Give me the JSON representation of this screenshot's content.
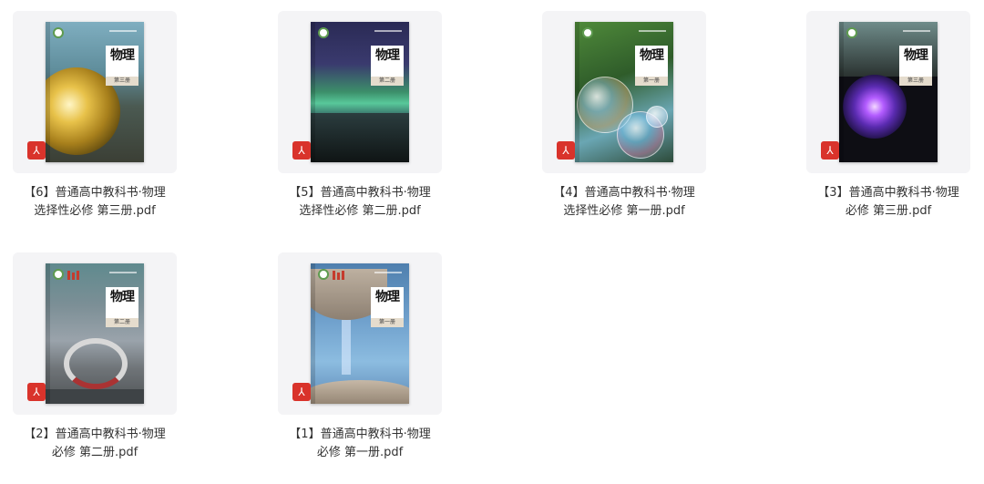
{
  "files": [
    {
      "line1": "【6】普通高中教科书·物理",
      "line2": "选择性必修 第三册.pdf",
      "cover_title": "物理",
      "volume": "第三册",
      "file_type_icon": "pdf-icon"
    },
    {
      "line1": "【5】普通高中教科书·物理",
      "line2": "选择性必修 第二册.pdf",
      "cover_title": "物理",
      "volume": "第二册",
      "file_type_icon": "pdf-icon"
    },
    {
      "line1": "【4】普通高中教科书·物理",
      "line2": "选择性必修 第一册.pdf",
      "cover_title": "物理",
      "volume": "第一册",
      "file_type_icon": "pdf-icon"
    },
    {
      "line1": "【3】普通高中教科书·物理",
      "line2": "必修 第三册.pdf",
      "cover_title": "物理",
      "volume": "第三册",
      "file_type_icon": "pdf-icon"
    },
    {
      "line1": "【2】普通高中教科书·物理",
      "line2": "必修 第二册.pdf",
      "cover_title": "物理",
      "volume": "第二册",
      "file_type_icon": "pdf-icon"
    },
    {
      "line1": "【1】普通高中教科书·物理",
      "line2": "必修 第一册.pdf",
      "cover_title": "物理",
      "volume": "第一册",
      "file_type_icon": "pdf-icon"
    }
  ],
  "colors": {
    "card_background": "#f4f4f6",
    "pdf_badge": "#d9332b",
    "caption_text": "#333333"
  }
}
